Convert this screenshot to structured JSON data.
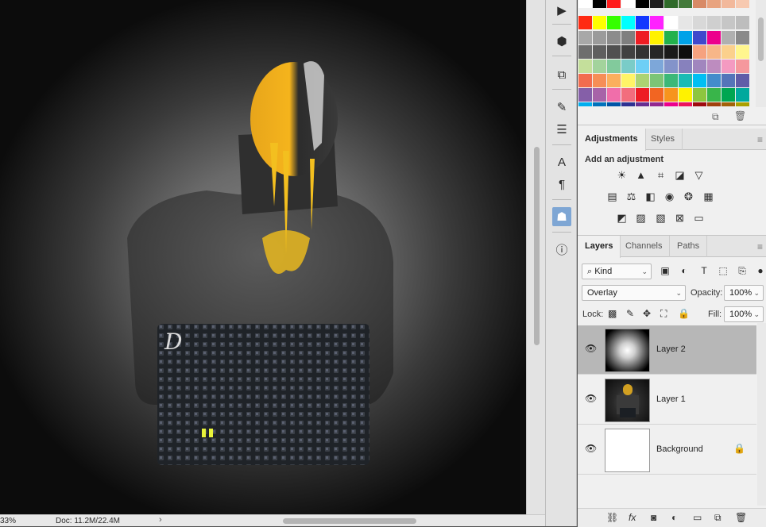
{
  "status_bar": {
    "zoom": "33%",
    "doc_info": "Doc: 11.2M/22.4M"
  },
  "toolbar": {
    "tools": [
      {
        "name": "play-icon",
        "glyph": "▶"
      },
      {
        "name": "3d-cube-icon",
        "glyph": "⬡"
      },
      {
        "name": "transform-icon",
        "glyph": "⧉"
      },
      {
        "name": "brushes-icon",
        "glyph": "✎"
      },
      {
        "name": "sliders-icon",
        "glyph": "☰"
      },
      {
        "name": "character-icon",
        "glyph": "A"
      },
      {
        "name": "paragraph-icon",
        "glyph": "¶"
      },
      {
        "name": "sketch-figure-icon",
        "glyph": "☗"
      },
      {
        "name": "info-icon",
        "glyph": "ⓘ"
      }
    ]
  },
  "swatches": {
    "top_row": [
      "#ffffff",
      "#000000",
      "#ff1b1b",
      "#ffffff",
      "#000000",
      "#1e1e1e",
      "#2f6b2a",
      "#437a3b",
      "#d88a66",
      "#e8a37f",
      "#f2b89b",
      "#f7c9b0"
    ],
    "rows": [
      [
        "#ff2a12",
        "#ffff00",
        "#35ff00",
        "#00ffff",
        "#1237ff",
        "#ff22ff",
        "#ffffff",
        "#e6e6e6",
        "#d8d8d8",
        "#cfcfcf",
        "#c6c6c6",
        "#bdbdbd"
      ],
      [
        "#a8a8a8",
        "#9b9b9b",
        "#8c8c8c",
        "#7f7f7f",
        "#ee1d24",
        "#fff200",
        "#22b14c",
        "#00a2e8",
        "#3f48cc",
        "#ec008c",
        "#b0b0b0",
        "#8a8a8a"
      ],
      [
        "#6e6e6e",
        "#5f5f5f",
        "#505050",
        "#414141",
        "#333333",
        "#262626",
        "#1a1a1a",
        "#0e0e0e",
        "#f6a27f",
        "#f7b688",
        "#fbd08c",
        "#fff68e"
      ],
      [
        "#c4df9b",
        "#a3d39c",
        "#82ca9c",
        "#7accc8",
        "#6dcff6",
        "#7da7d9",
        "#8393ca",
        "#8781bd",
        "#a186be",
        "#bd8cbf",
        "#f49ac1",
        "#f5989d"
      ],
      [
        "#f26c4f",
        "#f68e56",
        "#fbaf5d",
        "#fff467",
        "#acd372",
        "#7cc576",
        "#3bb878",
        "#1abbb4",
        "#00bff3",
        "#438ccb",
        "#5574b9",
        "#605ca8"
      ],
      [
        "#855fa8",
        "#a763a8",
        "#f06eaa",
        "#f26d7d",
        "#ed1c24",
        "#f26522",
        "#f7941d",
        "#fff200",
        "#8dc63f",
        "#39b54a",
        "#00a651",
        "#00a99d"
      ],
      [
        "#00aeef",
        "#0072bc",
        "#0054a6",
        "#2e3192",
        "#662d91",
        "#92278f",
        "#ec008c",
        "#ed145b",
        "#9e0b0f",
        "#a0410d",
        "#a36209",
        "#aba000"
      ]
    ]
  },
  "adjustments": {
    "tabs": [
      "Adjustments",
      "Styles"
    ],
    "heading": "Add an adjustment",
    "icons": [
      [
        "brightness-contrast-icon",
        "levels-icon",
        "curves-icon",
        "exposure-icon",
        "vibrance-icon"
      ],
      [
        "hue-saturation-icon",
        "color-balance-icon",
        "black-white-icon",
        "photo-filter-icon",
        "channel-mixer-icon",
        "color-lookup-icon"
      ],
      [
        "invert-icon",
        "posterize-icon",
        "threshold-icon",
        "selective-color-icon",
        "gradient-map-icon"
      ]
    ]
  },
  "layers": {
    "tabs": [
      "Layers",
      "Channels",
      "Paths"
    ],
    "filter_kind": "Kind",
    "blend_mode": "Overlay",
    "opacity_label": "Opacity:",
    "opacity_value": "100%",
    "lock_label": "Lock:",
    "fill_label": "Fill:",
    "fill_value": "100%",
    "items": [
      {
        "name": "Layer 2",
        "selected": true,
        "locked": false
      },
      {
        "name": "Layer 1",
        "selected": false,
        "locked": false
      },
      {
        "name": "Background",
        "selected": false,
        "locked": true
      }
    ]
  }
}
